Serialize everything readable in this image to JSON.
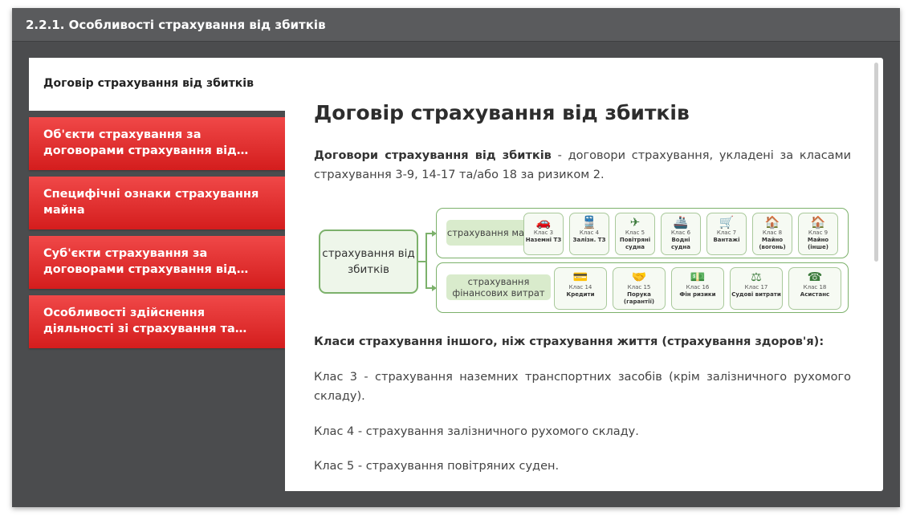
{
  "header": {
    "title": "2.2.1. Особливості страхування від збитків"
  },
  "tabs": [
    {
      "label": "Договір страхування від збитків",
      "active": true
    },
    {
      "label": "Об'єкти страхування за договорами страхування від збитків",
      "active": false
    },
    {
      "label": "Специфічні ознаки страхування майна",
      "active": false
    },
    {
      "label": "Суб'єкти страхування за договорами страхування від збитків",
      "active": false
    },
    {
      "label": "Особливості здійснення діяльності зі страхування та укладання договорів",
      "active": false
    }
  ],
  "content": {
    "title": "Договір страхування від збитків",
    "intro_bold": "Договори страхування від збитків",
    "intro_rest": " - договори страхування, укладені за класами страхування 3-9, 14-17 та/або 18 за ризиком 2.",
    "scheme": {
      "root": "страхування від збитків",
      "branches": [
        {
          "label": "страхування майна",
          "classes": [
            {
              "icon": "car-icon",
              "glyph": "🚗",
              "num": "Клас 3",
              "name": "Наземні ТЗ"
            },
            {
              "icon": "train-icon",
              "glyph": "🚆",
              "num": "Клас 4",
              "name": "Залізн. ТЗ"
            },
            {
              "icon": "airplane-icon",
              "glyph": "✈",
              "num": "Клас 5",
              "name": "Повітряні судна"
            },
            {
              "icon": "ship-icon",
              "glyph": "🚢",
              "num": "Клас 6",
              "name": "Водні судна"
            },
            {
              "icon": "cart-icon",
              "glyph": "🛒",
              "num": "Клас 7",
              "name": "Вантажі"
            },
            {
              "icon": "house-fire-icon",
              "glyph": "🏠",
              "num": "Клас 8",
              "name": "Майно (вогонь)"
            },
            {
              "icon": "house-icon",
              "glyph": "🏠",
              "num": "Клас 9",
              "name": "Майно (інше)"
            }
          ]
        },
        {
          "label": "страхування фінансових витрат",
          "classes": [
            {
              "icon": "credit-icon",
              "glyph": "💳",
              "num": "Клас 14",
              "name": "Кредити"
            },
            {
              "icon": "guarantee-icon",
              "glyph": "🤝",
              "num": "Клас 15",
              "name": "Порука (гарантії)"
            },
            {
              "icon": "money-icon",
              "glyph": "💵",
              "num": "Клас 16",
              "name": "Фін ризики"
            },
            {
              "icon": "scales-icon",
              "glyph": "⚖",
              "num": "Клас 17",
              "name": "Судові витрати"
            },
            {
              "icon": "assistance-icon",
              "glyph": "☎",
              "num": "Клас 18",
              "name": "Асистанс"
            }
          ]
        }
      ]
    },
    "section_title": "Класи страхування іншого, ніж страхування життя (страхування здоров'я):",
    "paragraphs": [
      "Клас 3 - страхування наземних транспортних засобів (крім залізничного рухомого складу).",
      "Клас 4 - страхування залізничного рухомого складу.",
      "Клас 5 - страхування повітряних суден."
    ]
  }
}
